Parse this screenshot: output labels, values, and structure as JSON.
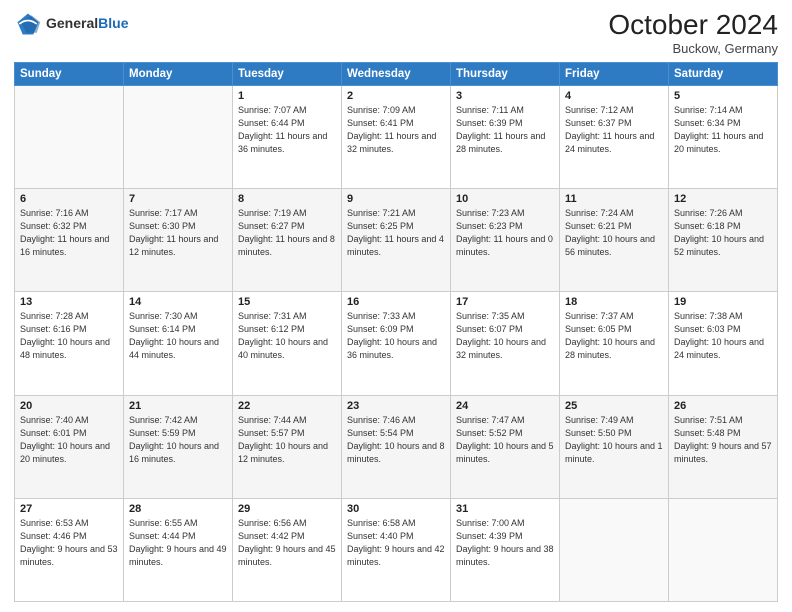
{
  "header": {
    "logo_general": "General",
    "logo_blue": "Blue",
    "month": "October 2024",
    "location": "Buckow, Germany"
  },
  "weekdays": [
    "Sunday",
    "Monday",
    "Tuesday",
    "Wednesday",
    "Thursday",
    "Friday",
    "Saturday"
  ],
  "weeks": [
    [
      {
        "day": "",
        "sunrise": "",
        "sunset": "",
        "daylight": ""
      },
      {
        "day": "",
        "sunrise": "",
        "sunset": "",
        "daylight": ""
      },
      {
        "day": "1",
        "sunrise": "Sunrise: 7:07 AM",
        "sunset": "Sunset: 6:44 PM",
        "daylight": "Daylight: 11 hours and 36 minutes."
      },
      {
        "day": "2",
        "sunrise": "Sunrise: 7:09 AM",
        "sunset": "Sunset: 6:41 PM",
        "daylight": "Daylight: 11 hours and 32 minutes."
      },
      {
        "day": "3",
        "sunrise": "Sunrise: 7:11 AM",
        "sunset": "Sunset: 6:39 PM",
        "daylight": "Daylight: 11 hours and 28 minutes."
      },
      {
        "day": "4",
        "sunrise": "Sunrise: 7:12 AM",
        "sunset": "Sunset: 6:37 PM",
        "daylight": "Daylight: 11 hours and 24 minutes."
      },
      {
        "day": "5",
        "sunrise": "Sunrise: 7:14 AM",
        "sunset": "Sunset: 6:34 PM",
        "daylight": "Daylight: 11 hours and 20 minutes."
      }
    ],
    [
      {
        "day": "6",
        "sunrise": "Sunrise: 7:16 AM",
        "sunset": "Sunset: 6:32 PM",
        "daylight": "Daylight: 11 hours and 16 minutes."
      },
      {
        "day": "7",
        "sunrise": "Sunrise: 7:17 AM",
        "sunset": "Sunset: 6:30 PM",
        "daylight": "Daylight: 11 hours and 12 minutes."
      },
      {
        "day": "8",
        "sunrise": "Sunrise: 7:19 AM",
        "sunset": "Sunset: 6:27 PM",
        "daylight": "Daylight: 11 hours and 8 minutes."
      },
      {
        "day": "9",
        "sunrise": "Sunrise: 7:21 AM",
        "sunset": "Sunset: 6:25 PM",
        "daylight": "Daylight: 11 hours and 4 minutes."
      },
      {
        "day": "10",
        "sunrise": "Sunrise: 7:23 AM",
        "sunset": "Sunset: 6:23 PM",
        "daylight": "Daylight: 11 hours and 0 minutes."
      },
      {
        "day": "11",
        "sunrise": "Sunrise: 7:24 AM",
        "sunset": "Sunset: 6:21 PM",
        "daylight": "Daylight: 10 hours and 56 minutes."
      },
      {
        "day": "12",
        "sunrise": "Sunrise: 7:26 AM",
        "sunset": "Sunset: 6:18 PM",
        "daylight": "Daylight: 10 hours and 52 minutes."
      }
    ],
    [
      {
        "day": "13",
        "sunrise": "Sunrise: 7:28 AM",
        "sunset": "Sunset: 6:16 PM",
        "daylight": "Daylight: 10 hours and 48 minutes."
      },
      {
        "day": "14",
        "sunrise": "Sunrise: 7:30 AM",
        "sunset": "Sunset: 6:14 PM",
        "daylight": "Daylight: 10 hours and 44 minutes."
      },
      {
        "day": "15",
        "sunrise": "Sunrise: 7:31 AM",
        "sunset": "Sunset: 6:12 PM",
        "daylight": "Daylight: 10 hours and 40 minutes."
      },
      {
        "day": "16",
        "sunrise": "Sunrise: 7:33 AM",
        "sunset": "Sunset: 6:09 PM",
        "daylight": "Daylight: 10 hours and 36 minutes."
      },
      {
        "day": "17",
        "sunrise": "Sunrise: 7:35 AM",
        "sunset": "Sunset: 6:07 PM",
        "daylight": "Daylight: 10 hours and 32 minutes."
      },
      {
        "day": "18",
        "sunrise": "Sunrise: 7:37 AM",
        "sunset": "Sunset: 6:05 PM",
        "daylight": "Daylight: 10 hours and 28 minutes."
      },
      {
        "day": "19",
        "sunrise": "Sunrise: 7:38 AM",
        "sunset": "Sunset: 6:03 PM",
        "daylight": "Daylight: 10 hours and 24 minutes."
      }
    ],
    [
      {
        "day": "20",
        "sunrise": "Sunrise: 7:40 AM",
        "sunset": "Sunset: 6:01 PM",
        "daylight": "Daylight: 10 hours and 20 minutes."
      },
      {
        "day": "21",
        "sunrise": "Sunrise: 7:42 AM",
        "sunset": "Sunset: 5:59 PM",
        "daylight": "Daylight: 10 hours and 16 minutes."
      },
      {
        "day": "22",
        "sunrise": "Sunrise: 7:44 AM",
        "sunset": "Sunset: 5:57 PM",
        "daylight": "Daylight: 10 hours and 12 minutes."
      },
      {
        "day": "23",
        "sunrise": "Sunrise: 7:46 AM",
        "sunset": "Sunset: 5:54 PM",
        "daylight": "Daylight: 10 hours and 8 minutes."
      },
      {
        "day": "24",
        "sunrise": "Sunrise: 7:47 AM",
        "sunset": "Sunset: 5:52 PM",
        "daylight": "Daylight: 10 hours and 5 minutes."
      },
      {
        "day": "25",
        "sunrise": "Sunrise: 7:49 AM",
        "sunset": "Sunset: 5:50 PM",
        "daylight": "Daylight: 10 hours and 1 minute."
      },
      {
        "day": "26",
        "sunrise": "Sunrise: 7:51 AM",
        "sunset": "Sunset: 5:48 PM",
        "daylight": "Daylight: 9 hours and 57 minutes."
      }
    ],
    [
      {
        "day": "27",
        "sunrise": "Sunrise: 6:53 AM",
        "sunset": "Sunset: 4:46 PM",
        "daylight": "Daylight: 9 hours and 53 minutes."
      },
      {
        "day": "28",
        "sunrise": "Sunrise: 6:55 AM",
        "sunset": "Sunset: 4:44 PM",
        "daylight": "Daylight: 9 hours and 49 minutes."
      },
      {
        "day": "29",
        "sunrise": "Sunrise: 6:56 AM",
        "sunset": "Sunset: 4:42 PM",
        "daylight": "Daylight: 9 hours and 45 minutes."
      },
      {
        "day": "30",
        "sunrise": "Sunrise: 6:58 AM",
        "sunset": "Sunset: 4:40 PM",
        "daylight": "Daylight: 9 hours and 42 minutes."
      },
      {
        "day": "31",
        "sunrise": "Sunrise: 7:00 AM",
        "sunset": "Sunset: 4:39 PM",
        "daylight": "Daylight: 9 hours and 38 minutes."
      },
      {
        "day": "",
        "sunrise": "",
        "sunset": "",
        "daylight": ""
      },
      {
        "day": "",
        "sunrise": "",
        "sunset": "",
        "daylight": ""
      }
    ]
  ]
}
